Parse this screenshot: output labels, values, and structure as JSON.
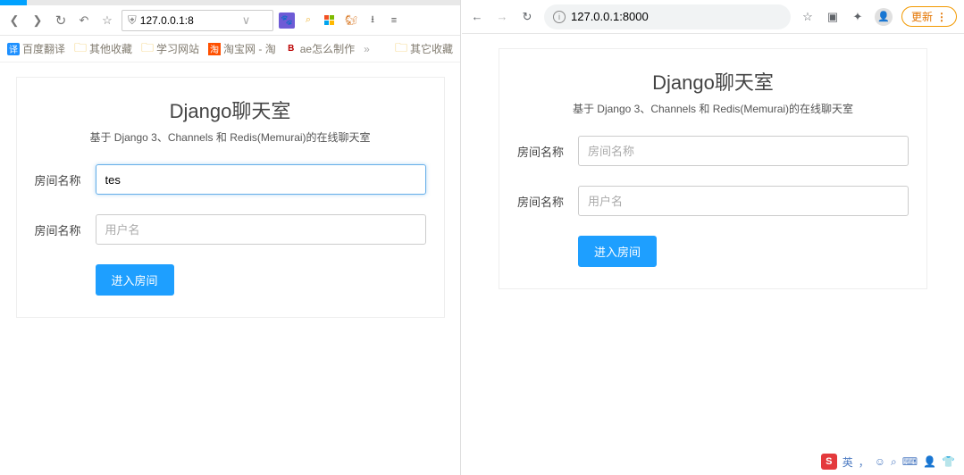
{
  "left": {
    "toolbar": {
      "back": "<",
      "forward": ">",
      "reload": "C",
      "undo": "↶",
      "star": "☆",
      "shield": "⛨",
      "url": "127.0.0.1:8",
      "drop": "∨",
      "paw": "🐾",
      "search_icon": "search",
      "ms": "ms",
      "squirrel": "squirrel",
      "download": "⭳",
      "menu": "≡"
    },
    "bookmarks": {
      "b1": "百度翻译",
      "b2": "其他收藏",
      "b3": "学习网站",
      "b4": "淘宝网 - 淘",
      "b5": "ae怎么制作",
      "more": "»",
      "last": "其它收藏"
    },
    "page": {
      "title": "Django聊天室",
      "subtitle": "基于 Django 3、Channels 和 Redis(Memurai)的在线聊天室",
      "label_room": "房间名称",
      "room_value": "tes",
      "label_user": "房间名称",
      "user_placeholder": "用户名",
      "enter": "进入房间"
    }
  },
  "right": {
    "toolbar": {
      "back": "←",
      "forward": "→",
      "reload": "↻",
      "info": "i",
      "url": "127.0.0.1:8000",
      "star": "☆",
      "reader": "▣",
      "ext": "✦",
      "update": "更新",
      "menu": "⋮"
    },
    "page": {
      "title": "Django聊天室",
      "subtitle": "基于 Django 3、Channels 和 Redis(Memurai)的在线聊天室",
      "label_room": "房间名称",
      "room_placeholder": "房间名称",
      "label_user": "房间名称",
      "user_placeholder": "用户名",
      "enter": "进入房间"
    }
  },
  "ime": {
    "logo": "S",
    "lang": "英",
    "comma": "，",
    "face": "☺",
    "mic": "⌕",
    "kbd": "⌨",
    "cloth": "👕",
    "user": "👤"
  }
}
